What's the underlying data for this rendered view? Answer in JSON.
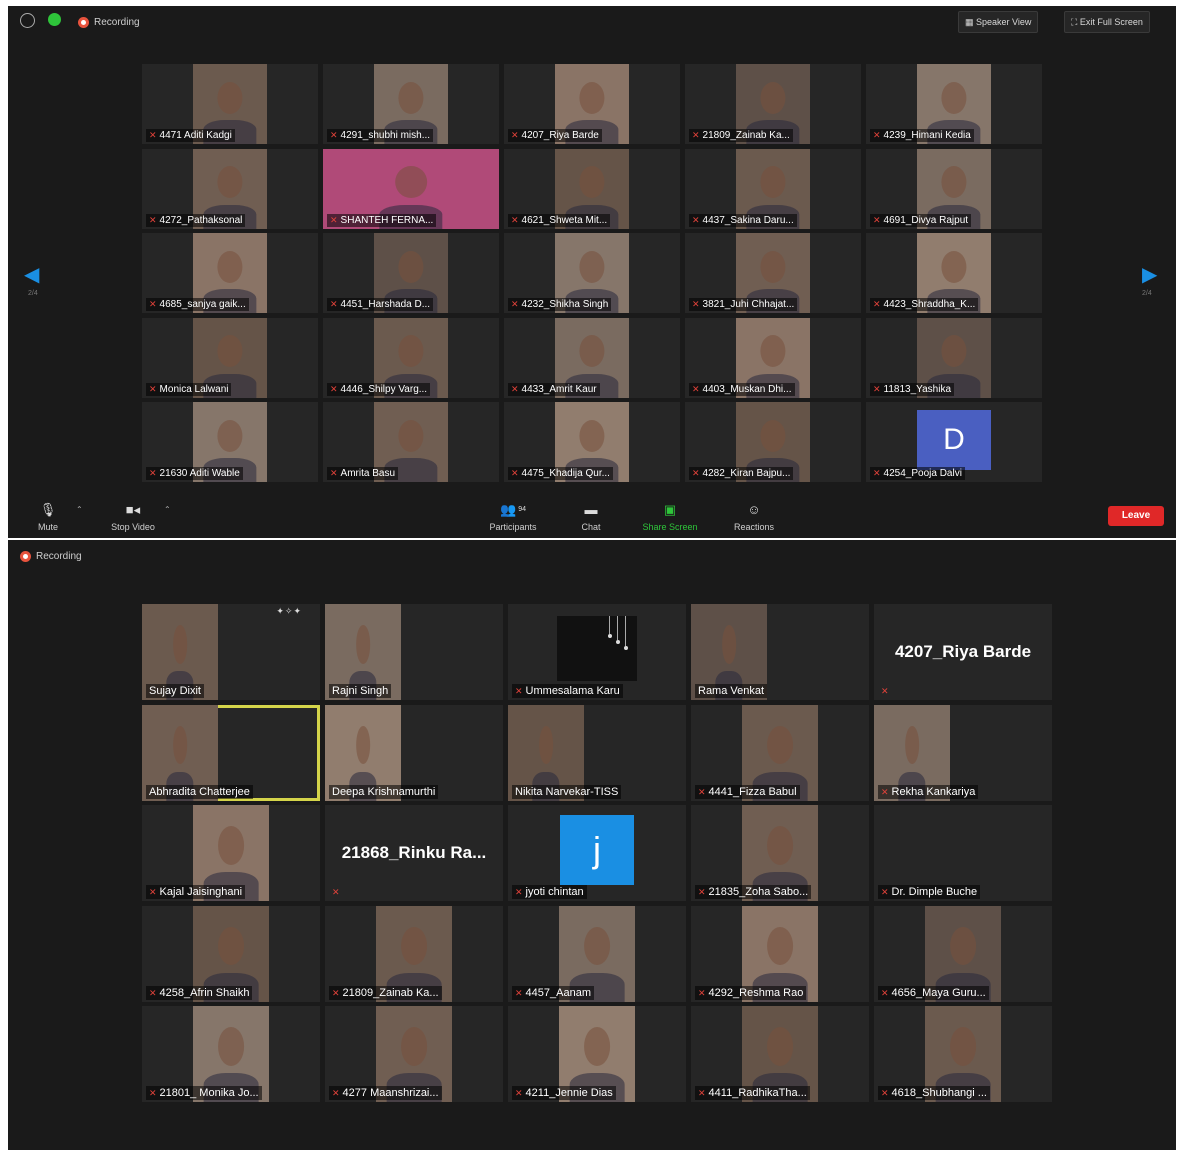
{
  "screen1": {
    "recording_label": "Recording",
    "speaker_view_label": "Speaker View",
    "exit_full_screen_label": "Exit Full Screen",
    "page_left": "2/4",
    "page_right": "2/4",
    "tiles": [
      {
        "name": "4471 Aditi Kadgi",
        "kind": "video"
      },
      {
        "name": "4291_shubhi mish...",
        "kind": "video"
      },
      {
        "name": "4207_Riya Barde",
        "kind": "video"
      },
      {
        "name": "21809_Zainab Ka...",
        "kind": "video"
      },
      {
        "name": "4239_Himani Kedia",
        "kind": "video"
      },
      {
        "name": "4272_Pathaksonal",
        "kind": "video"
      },
      {
        "name": "SHANTEH FERNA...",
        "kind": "wide"
      },
      {
        "name": "4621_Shweta Mit...",
        "kind": "video"
      },
      {
        "name": "4437_Sakina Daru...",
        "kind": "video"
      },
      {
        "name": "4691_Divya Rajput",
        "kind": "video"
      },
      {
        "name": "4685_sanjya gaik...",
        "kind": "video"
      },
      {
        "name": "4451_Harshada D...",
        "kind": "video"
      },
      {
        "name": "4232_Shikha Singh",
        "kind": "video"
      },
      {
        "name": "3821_Juhi Chhajat...",
        "kind": "video"
      },
      {
        "name": "4423_Shraddha_K...",
        "kind": "video"
      },
      {
        "name": "Monica Lalwani",
        "kind": "video"
      },
      {
        "name": "4446_Shilpy Varg...",
        "kind": "video"
      },
      {
        "name": "4433_Amrit Kaur",
        "kind": "video"
      },
      {
        "name": "4403_Muskan Dhi...",
        "kind": "video"
      },
      {
        "name": "11813_Yashika",
        "kind": "video"
      },
      {
        "name": "21630 Aditi Wable",
        "kind": "video"
      },
      {
        "name": "Amrita Basu",
        "kind": "video"
      },
      {
        "name": "4475_Khadija Qur...",
        "kind": "video"
      },
      {
        "name": "4282_Kiran Bajpu...",
        "kind": "video"
      },
      {
        "name": "4254_Pooja Dalvi",
        "kind": "avatar",
        "letter": "D",
        "color": "#4a5fc1"
      }
    ],
    "toolbar": {
      "mute": "Mute",
      "stop_video": "Stop Video",
      "participants": "Participants",
      "participants_count": "94",
      "chat": "Chat",
      "share_screen": "Share Screen",
      "reactions": "Reactions",
      "leave": "Leave"
    }
  },
  "screen2": {
    "recording_label": "Recording",
    "tiles": [
      {
        "name": "Sujay Dixit",
        "kind": "full",
        "mic": false
      },
      {
        "name": "Rajni Singh",
        "kind": "full",
        "mic": false
      },
      {
        "name": "Ummesalama Karu",
        "kind": "decor",
        "mic": true
      },
      {
        "name": "Rama Venkat",
        "kind": "full",
        "mic": false
      },
      {
        "name": "",
        "kind": "bigname",
        "big": "4207_Riya Barde",
        "mic": true
      },
      {
        "name": "Abhradita Chatterjee",
        "kind": "full",
        "mic": false,
        "highlight": true
      },
      {
        "name": "Deepa Krishnamurthi",
        "kind": "full",
        "mic": false
      },
      {
        "name": "Nikita Narvekar-TISS",
        "kind": "full",
        "mic": false
      },
      {
        "name": "4441_Fizza Babul",
        "kind": "video",
        "mic": true
      },
      {
        "name": "Rekha Kankariya",
        "kind": "full",
        "mic": true
      },
      {
        "name": "Kajal Jaisinghani",
        "kind": "video",
        "mic": true
      },
      {
        "name": "",
        "kind": "bigname",
        "big": "21868_Rinku  Ra...",
        "mic": true
      },
      {
        "name": "jyoti chintan",
        "kind": "avatar",
        "letter": "j",
        "color": "#1a8fe3",
        "mic": true
      },
      {
        "name": "21835_Zoha Sabo...",
        "kind": "video",
        "mic": true
      },
      {
        "name": "Dr. Dimple Buche",
        "kind": "empty",
        "mic": true
      },
      {
        "name": "4258_Afrin Shaikh",
        "kind": "video",
        "mic": true
      },
      {
        "name": "21809_Zainab Ka...",
        "kind": "video",
        "mic": true
      },
      {
        "name": "4457_Aanam",
        "kind": "video",
        "mic": true
      },
      {
        "name": "4292_Reshma Rao",
        "kind": "video",
        "mic": true
      },
      {
        "name": "4656_Maya Guru...",
        "kind": "video",
        "mic": true
      },
      {
        "name": "21801_ Monika Jo...",
        "kind": "video",
        "mic": true
      },
      {
        "name": "4277 Maanshrizai...",
        "kind": "video",
        "mic": true
      },
      {
        "name": "4211_Jennie Dias",
        "kind": "video",
        "mic": true
      },
      {
        "name": "4411_RadhikaTha...",
        "kind": "video",
        "mic": true
      },
      {
        "name": "4618_Shubhangi ...",
        "kind": "video",
        "mic": true
      }
    ]
  }
}
